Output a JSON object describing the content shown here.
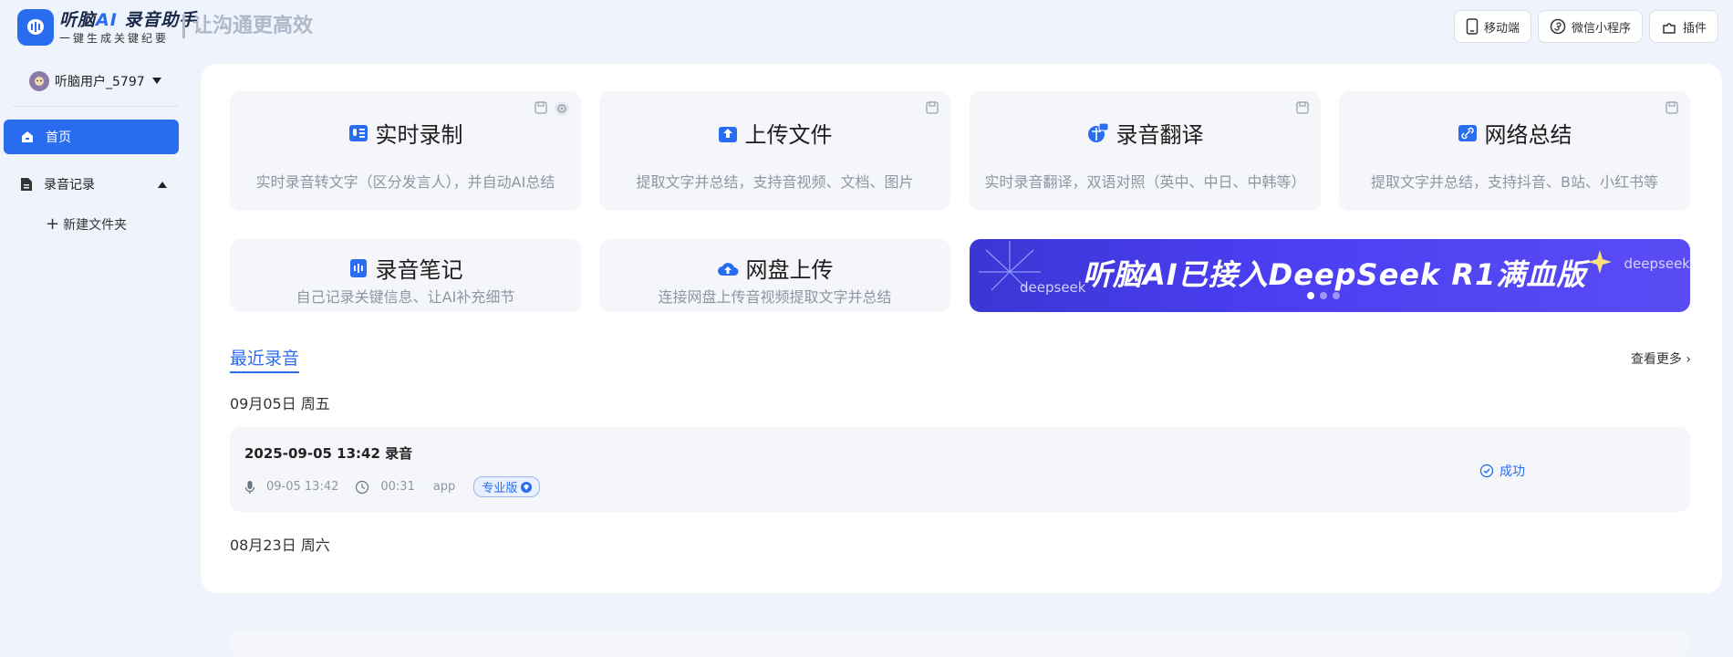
{
  "app": {
    "logo_main": "听脑",
    "logo_ai": "AI",
    "logo_main2": " 录音助手",
    "logo_sub": "一键生成关键纪要",
    "slogan": "让沟通更高效"
  },
  "top_actions": [
    {
      "label": "移动端",
      "icon": "mobile-icon"
    },
    {
      "label": "微信小程序",
      "icon": "mini-program-icon"
    },
    {
      "label": "插件",
      "icon": "plugin-icon"
    }
  ],
  "user": {
    "name": "听脑用户_5797"
  },
  "sidebar": {
    "home": "首页",
    "records": "录音记录",
    "new_folder": "新建文件夹"
  },
  "cards": [
    {
      "title": "实时录制",
      "desc": "实时录音转文字（区分发言人），并自动AI总结",
      "icon": "realtime-record-icon"
    },
    {
      "title": "上传文件",
      "desc": "提取文字并总结，支持音视频、文档、图片",
      "icon": "upload-icon"
    },
    {
      "title": "录音翻译",
      "desc": "实时录音翻译，双语对照（英中、中日、中韩等）",
      "icon": "translate-icon"
    },
    {
      "title": "网络总结",
      "desc": "提取文字并总结，支持抖音、B站、小红书等",
      "icon": "link-icon"
    }
  ],
  "small_cards": [
    {
      "title": "录音笔记",
      "desc": "自己记录关键信息、让AI补充细节",
      "icon": "note-icon"
    },
    {
      "title": "网盘上传",
      "desc": "连接网盘上传音视频提取文字并总结",
      "icon": "cloud-upload-icon"
    }
  ],
  "banner": {
    "text": "听脑AI已接入DeepSeek R1满血版",
    "brand": "deepseek",
    "slides": 3,
    "active_slide": 1
  },
  "recent": {
    "title": "最近录音",
    "more": "查看更多",
    "groups": [
      {
        "date": "09月05日 周五",
        "items": [
          {
            "title": "2025-09-05 13:42 录音",
            "time": "09-05 13:42",
            "duration": "00:31",
            "source": "app",
            "badge": "专业版",
            "status": "成功"
          }
        ]
      },
      {
        "date": "08月23日 周六"
      }
    ]
  },
  "colors": {
    "accent": "#2a6cf0",
    "card_bg": "#f4f6fa",
    "page_bg": "#eef3fc"
  }
}
